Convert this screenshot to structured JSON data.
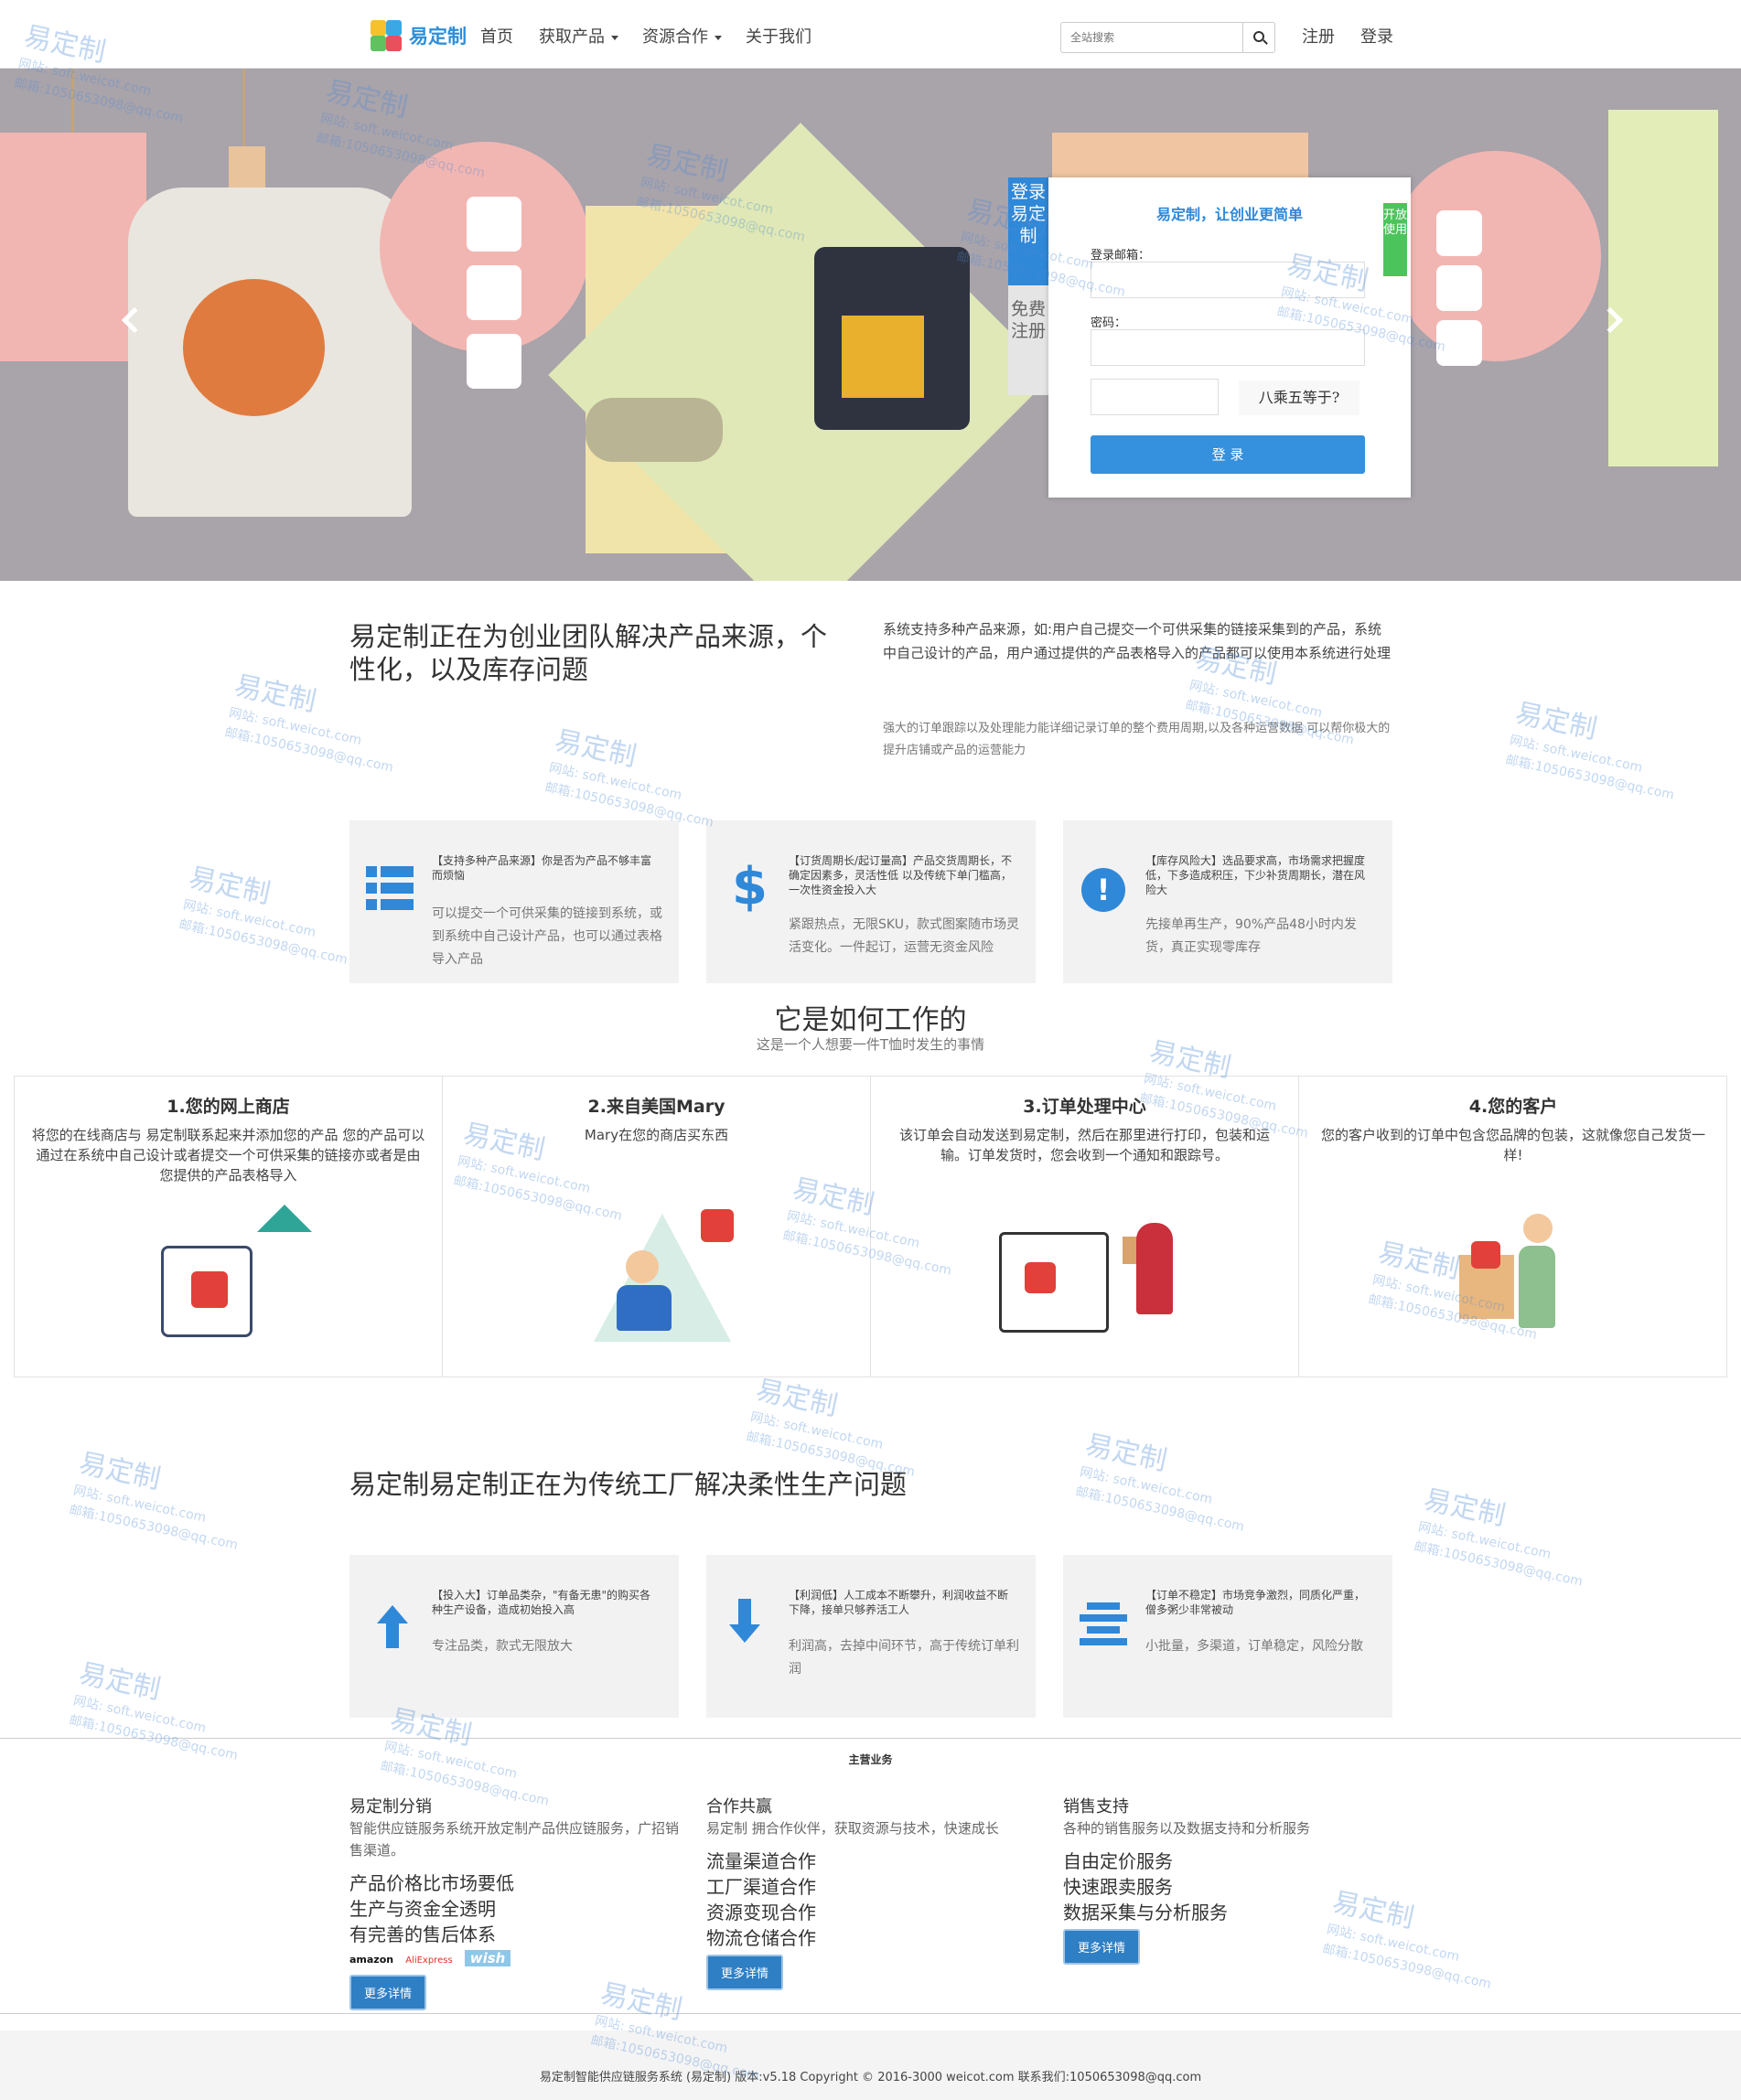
{
  "nav": {
    "brand": "易定制",
    "items": [
      {
        "label": "首页"
      },
      {
        "label": "获取产品"
      },
      {
        "label": "资源合作"
      },
      {
        "label": "关于我们"
      }
    ],
    "search_placeholder": "全站搜索",
    "register": "注册",
    "login": "登录"
  },
  "login_panel": {
    "tab_login": "登录易定制",
    "tab_register": "免费注册",
    "title": "易定制，让创业更简单",
    "open_badge": "开放使用",
    "email_label": "登录邮箱：",
    "password_label": "密码：",
    "captcha_text": "八乘五等于?",
    "submit": "登 录"
  },
  "intro": {
    "title": "易定制正在为创业团队解决产品来源，个性化，以及库存问题",
    "p1": "系统支持多种产品来源，如:用户自己提交一个可供采集的链接采集到的产品，系统中自己设计的产品，用户通过提供的产品表格导入的产品都可以使用本系统进行处理",
    "p2": "强大的订单跟踪以及处理能力能详细记录订单的整个费用周期,以及各种运营数据 可以帮你极大的提升店铺或产品的运营能力"
  },
  "features": [
    {
      "title": "【支持多种产品来源】你是否为产品不够丰富而烦恼",
      "desc": "可以提交一个可供采集的链接到系统，或到系统中自己设计产品，也可以通过表格导入产品"
    },
    {
      "title": "【订货周期长/起订量高】产品交货周期长，不确定因素多，灵活性低 以及传统下单门槛高，一次性资金投入大",
      "desc": "紧跟热点，无限SKU，款式图案随市场灵活变化。一件起订，运营无资金风险"
    },
    {
      "title": "【库存风险大】选品要求高，市场需求把握度低，下多造成积压，下少补货周期长，潜在风险大",
      "desc": "先接单再生产，90%产品48小时内发货，真正实现零库存"
    }
  ],
  "how": {
    "title": "它是如何工作的",
    "subtitle": "这是一个人想要一件T恤时发生的事情",
    "steps": [
      {
        "title": "1.您的网上商店",
        "desc": "将您的在线商店与 易定制联系起来并添加您的产品 您的产品可以通过在系统中自己设计或者提交一个可供采集的链接亦或者是由您提供的产品表格导入"
      },
      {
        "title": "2.来自美国Mary",
        "desc": "Mary在您的商店买东西"
      },
      {
        "title": "3.订单处理中心",
        "desc": "该订单会自动发送到易定制，然后在那里进行打印，包装和运输。订单发货时，您会收到一个通知和跟踪号。"
      },
      {
        "title": "4.您的客户",
        "desc": "您的客户收到的订单中包含您品牌的包装，这就像您自己发货一样!"
      }
    ]
  },
  "factory": {
    "title": "易定制易定制正在为传统工厂解决柔性生产问题",
    "cards": [
      {
        "title": "【投入大】订单品类杂，\"有备无患\"的购买各种生产设备，造成初始投入高",
        "desc": "专注品类，款式无限放大"
      },
      {
        "title": "【利润低】人工成本不断攀升，利润收益不断下降，接单只够养活工人",
        "desc": "利润高，去掉中间环节，高于传统订单利润"
      },
      {
        "title": "【订单不稳定】市场竞争激烈，同质化严重，僧多粥少非常被动",
        "desc": "小批量，多渠道，订单稳定，风险分散"
      }
    ]
  },
  "business": {
    "heading": "主营业务",
    "columns": [
      {
        "title": "易定制分销",
        "subtitle": "智能供应链服务系统开放定制产品供应链服务，广招销售渠道。",
        "items": [
          "产品价格比市场要低",
          "生产与资金全透明",
          "有完善的售后体系"
        ],
        "logos": [
          "amazon",
          "AliExpress",
          "wish"
        ],
        "button": "更多详情"
      },
      {
        "title": "合作共赢",
        "subtitle": "易定制 拥合作伙伴，获取资源与技术，快速成长",
        "items": [
          "流量渠道合作",
          "工厂渠道合作",
          "资源变现合作",
          "物流仓储合作"
        ],
        "button": "更多详情"
      },
      {
        "title": "销售支持",
        "subtitle": "各种的销售服务以及数据支持和分析服务",
        "items": [
          "自由定价服务",
          "快速跟卖服务",
          "数据采集与分析服务"
        ],
        "button": "更多详情"
      }
    ]
  },
  "footer": {
    "text": "易定制智能供应链服务系统 (易定制) 版本:v5.18 Copyright © 2016-3000 weicot.com 联系我们:1050653098@qq.com"
  },
  "watermark": {
    "brand": "易定制",
    "site": "网站: soft.weicot.com",
    "mail": "邮箱:1050653098@qq.com"
  },
  "colors": {
    "accent": "#2f88d8",
    "green_badge": "#4cc45c",
    "hero_bg": "#a9a3aa",
    "card_bg": "#f2f2f2"
  }
}
